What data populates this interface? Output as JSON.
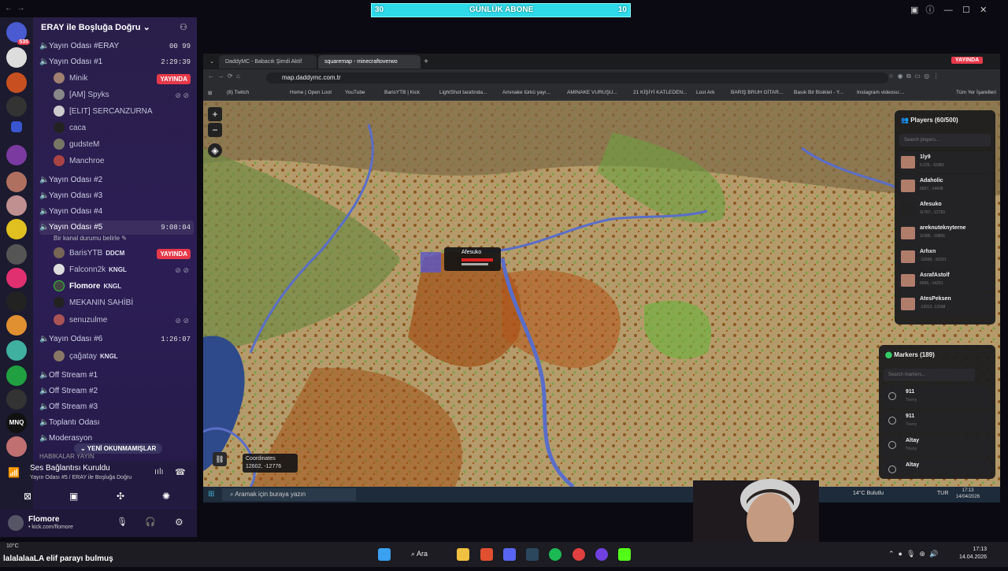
{
  "goal": {
    "left": "30",
    "title": "GÜNLÜK ABONE",
    "right": "10"
  },
  "discord": {
    "server_badge": "535",
    "server_name": "ERAY ile Boşluğa Doğru",
    "channels": [
      {
        "name": "Yayın Odası #ERAY",
        "time": "00 99"
      },
      {
        "name": "Yayın Odası #1",
        "time": "2:29:39"
      },
      {
        "name": "Yayın Odası #2",
        "time": ""
      },
      {
        "name": "Yayın Odası #3",
        "time": ""
      },
      {
        "name": "Yayın Odası #4",
        "time": ""
      },
      {
        "name": "Yayın Odası #5",
        "time": "9:08:04",
        "status": "Bir kanal durumu belirle"
      },
      {
        "name": "Yayın Odası #6",
        "time": "1:26:07"
      },
      {
        "name": "Off Stream #1",
        "time": ""
      },
      {
        "name": "Off Stream #2",
        "time": ""
      },
      {
        "name": "Off Stream #3",
        "time": ""
      },
      {
        "name": "Toplantı Odası",
        "time": ""
      },
      {
        "name": "Moderasyon",
        "time": ""
      }
    ],
    "users_room1": [
      "Minik",
      "[AM] Spyks",
      "[ELIT] SERCANZURNA",
      "caca",
      "gudsteM",
      "Manchroe"
    ],
    "users_room5": [
      {
        "name": "BarisYTB",
        "tag": "DDCM"
      },
      {
        "name": "Falconn2k",
        "tag": "KNGL"
      },
      {
        "name": "Flomore",
        "tag": "KNGL"
      },
      {
        "name": "MEKANIN SAHİBİ",
        "tag": ""
      },
      {
        "name": "senuzulme",
        "tag": ""
      }
    ],
    "users_room6": [
      {
        "name": "çağatay",
        "tag": "KNGL"
      }
    ],
    "live_label": "YAYINDA",
    "unread_label": "YENİ OKUNMAMIŞLAR",
    "category": "HABIKALAR YAYIN",
    "voice_title": "Ses Bağlantısı Kuruldu",
    "voice_sub": "Yayın Odası #5 / ERAY ile Boşluğa Doğru",
    "self_name": "Flomore",
    "self_status": "• kick.com/flomore"
  },
  "browser": {
    "tabs": [
      "DaddyMC - Babacık Şimdi Aktif",
      "squaremap - minecraftoverwo"
    ],
    "live_tag": "YAYINDA",
    "url": "map.daddymc.com.tr",
    "bookmarks": [
      "(8) Twitch",
      "Home | Open Loot",
      "YouTube",
      "BarisYTB | Kick",
      "LightShot tarafında...",
      "Amınake türkü yayı...",
      "AMINAKE VURUŞU...",
      "21 KİŞİYİ KATLEDEN...",
      "Lost Ark",
      "BARIŞ BRUH GİTAR...",
      "Basık Bir Bisiklet - Y...",
      "Instagram videosu:...",
      "Tüm Yer İşaretleri"
    ]
  },
  "map": {
    "coords_label": "Coordinates",
    "coords_value": "12602, -12776",
    "tooltip_name": "Afesuko",
    "players_title": "Players (60/500)",
    "players_search": "Search players...",
    "players": [
      {
        "name": "1ly9",
        "coords": "6.226, -11983"
      },
      {
        "name": "Adaholic",
        "coords": "9007, -14438"
      },
      {
        "name": "Afesuko",
        "coords": "11767, -12783"
      },
      {
        "name": "areknuteknyterne",
        "coords": "11986, -10866"
      },
      {
        "name": "Arhxn",
        "coords": "-11658, -10291"
      },
      {
        "name": "AsrafAstolf",
        "coords": "6065, -14291"
      },
      {
        "name": "AtesPeksen",
        "coords": "-12012, 12398"
      }
    ],
    "markers_title": "Markers (189)",
    "markers_search": "Search markers...",
    "markers": [
      {
        "name": "911",
        "sub": "Towny"
      },
      {
        "name": "911",
        "sub": "Towny"
      },
      {
        "name": "Altay",
        "sub": "Towny"
      },
      {
        "name": "Altay",
        "sub": ""
      }
    ]
  },
  "inner_taskbar": {
    "search": "Aramak için buraya yazın",
    "weather": "14°C  Bulutlu",
    "lang": "TUR",
    "time": "17:13",
    "date": "14/04/2026"
  },
  "taskbar": {
    "weather": "10°C",
    "ticker": "lalalalaaLA elif parayı bulmuş",
    "search": "Ara",
    "time": "17:13",
    "date": "14.04.2026"
  },
  "colors": {
    "live": "#e5394a",
    "accent": "#2fd9e8"
  }
}
